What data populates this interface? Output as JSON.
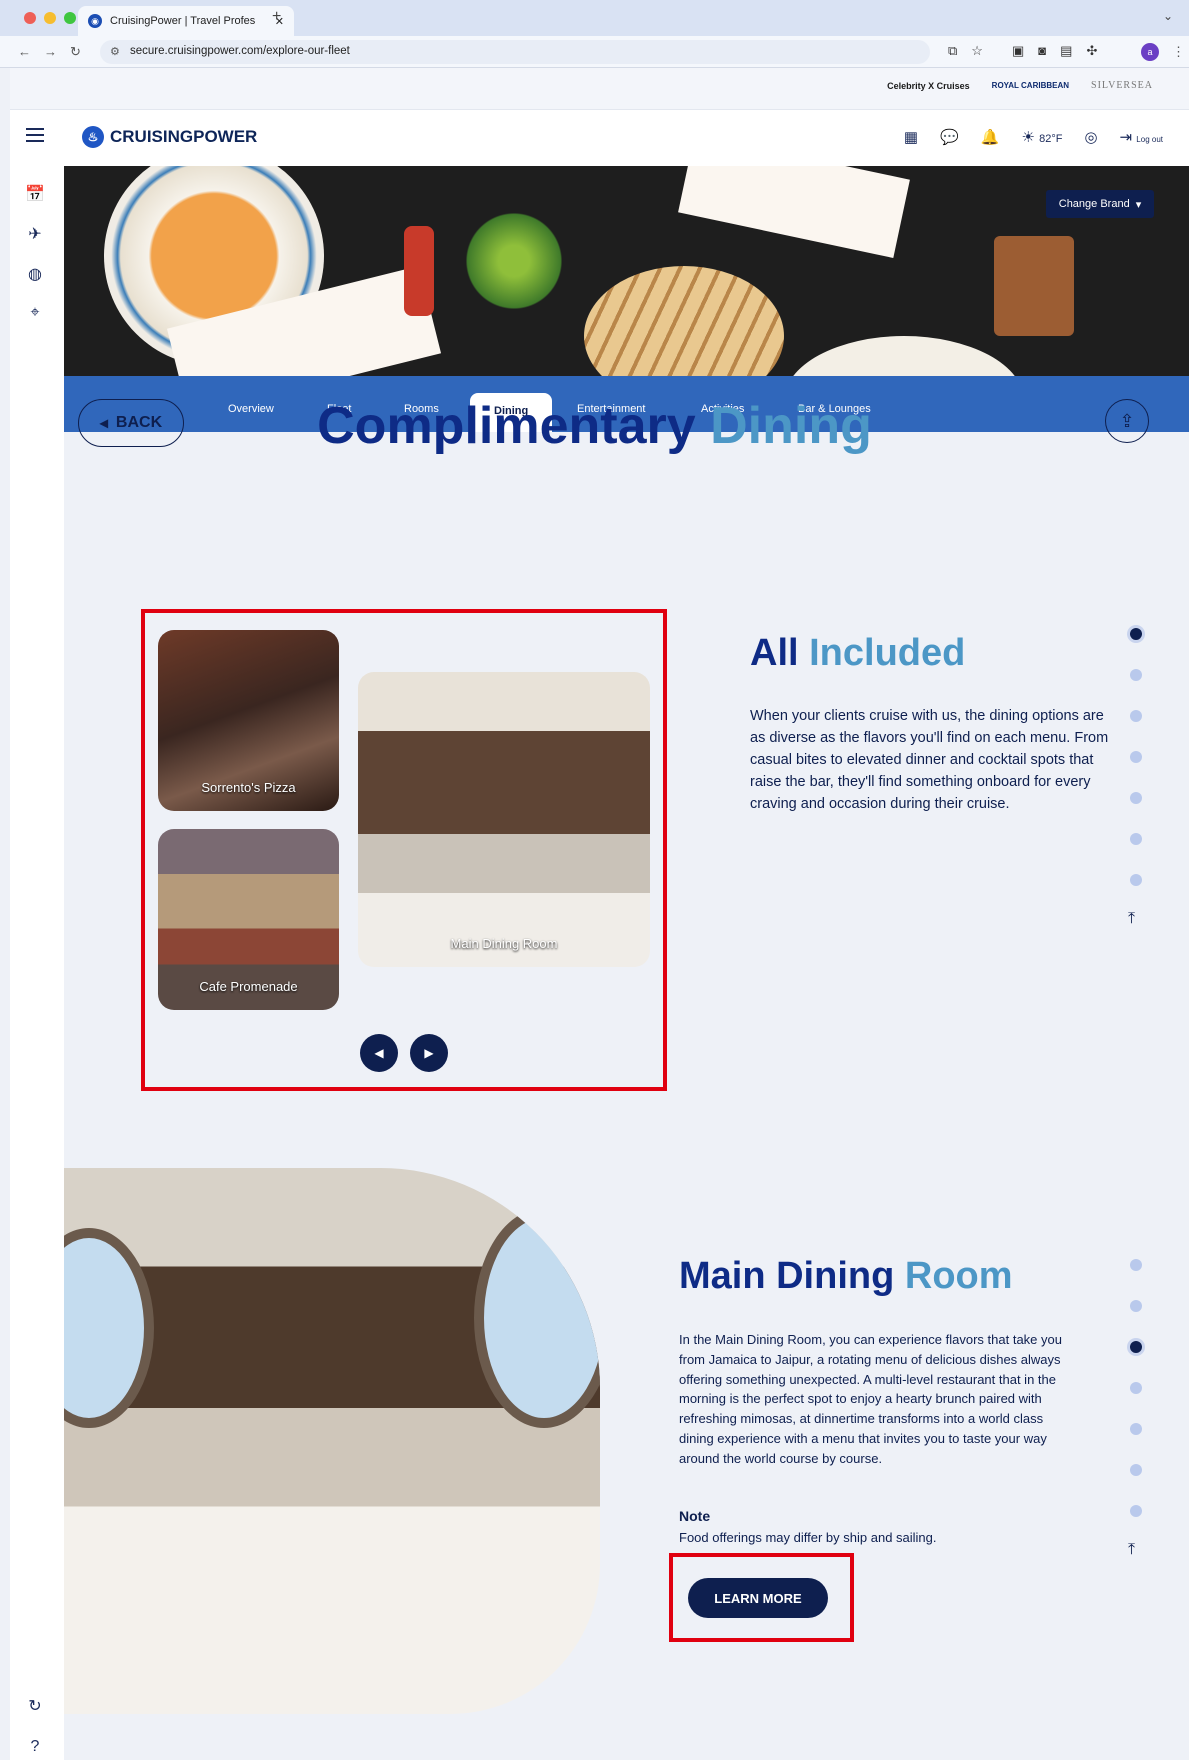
{
  "browser": {
    "tab_title": "CruisingPower | Travel Profes",
    "url": "secure.cruisingpower.com/explore-our-fleet"
  },
  "brands": [
    "Celebrity X Cruises",
    "ROYAL CARIBBEAN",
    "SILVERSEA"
  ],
  "header": {
    "logo_text": "CRUISINGPOWER",
    "temperature": "82°F",
    "logout_label": "Log out"
  },
  "hero": {
    "change_brand_label": "Change Brand"
  },
  "nav_tabs": [
    "Overview",
    "Fleet",
    "Rooms",
    "Dining",
    "Entertainment",
    "Activities",
    "Bar & Lounges"
  ],
  "active_tab": "Dining",
  "page": {
    "back_label": "BACK",
    "title_part1": "Complimentary",
    "title_part2": "Dining"
  },
  "gallery": {
    "items": [
      {
        "caption": "Sorrento's Pizza"
      },
      {
        "caption": "Main Dining Room"
      },
      {
        "caption": "Cafe Promenade"
      }
    ]
  },
  "section1": {
    "title_part1": "All",
    "title_part2": "Included",
    "body": "When your clients cruise with us, the dining options are as diverse as the flavors you'll find on each menu. From casual bites to elevated dinner and cocktail spots that raise the bar, they'll find something onboard for every craving and occasion during their cruise."
  },
  "section2": {
    "title_part1": "Main Dining",
    "title_part2": "Room",
    "body": "In the Main Dining Room, you can experience flavors that take you from Jamaica to Jaipur, a rotating menu of delicious dishes always offering something unexpected. A multi-level restaurant that in the morning is the perfect spot to enjoy a hearty brunch paired with refreshing mimosas, at dinnertime transforms into a world class dining experience with a menu that invites you to taste your way around the world course by course.",
    "note_heading": "Note",
    "note_text": "Food offerings may differ by ship and sailing.",
    "learn_more_label": "LEARN MORE"
  },
  "colors": {
    "navy": "#0e1f4f",
    "nav_blue": "#3067bb",
    "title_light": "#4c97c6",
    "highlight_red": "#e00010"
  }
}
